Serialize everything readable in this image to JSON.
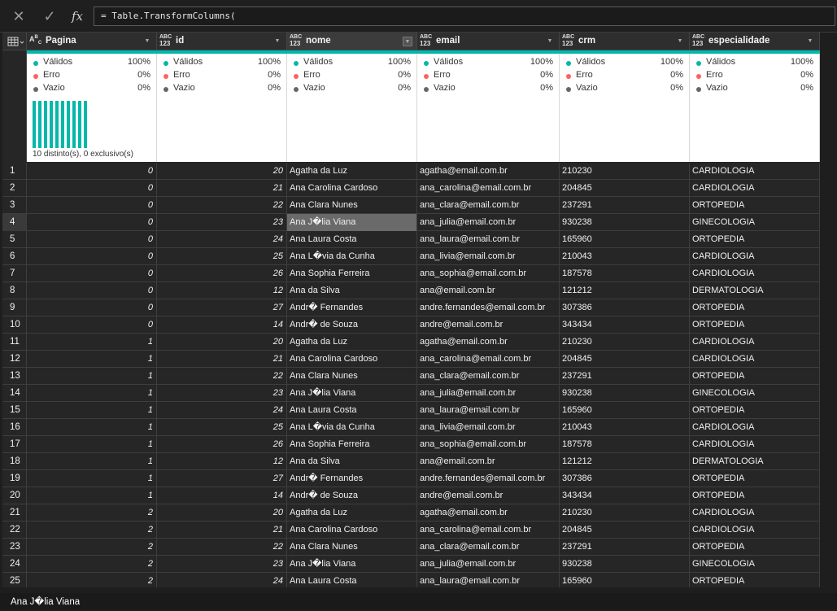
{
  "formula_bar": {
    "cancel_icon": "close-icon",
    "confirm_icon": "check-icon",
    "fx_label": "fx",
    "formula": "= Table.TransformColumns("
  },
  "columns": [
    {
      "name": "Pagina",
      "type": "ABC",
      "valid": "100%",
      "error": "0%",
      "empty": "0%",
      "numeric": true
    },
    {
      "name": "id",
      "type": "ABC123",
      "valid": "100%",
      "error": "0%",
      "empty": "0%",
      "numeric": true
    },
    {
      "name": "nome",
      "type": "ABC123",
      "valid": "100%",
      "error": "0%",
      "empty": "0%",
      "numeric": false
    },
    {
      "name": "email",
      "type": "ABC123",
      "valid": "100%",
      "error": "0%",
      "empty": "0%",
      "numeric": false
    },
    {
      "name": "crm",
      "type": "ABC123",
      "valid": "100%",
      "error": "0%",
      "empty": "0%",
      "numeric": false
    },
    {
      "name": "especialidade",
      "type": "ABC123",
      "valid": "100%",
      "error": "0%",
      "empty": "0%",
      "numeric": false
    }
  ],
  "profile_labels": {
    "valid": "Válidos",
    "error": "Erro",
    "empty": "Vazio"
  },
  "profile_colors": {
    "valid": "#01b8aa",
    "error": "#fd625e",
    "empty": "#666666",
    "accent": "#01b8aa"
  },
  "distinct_text": "10 distinto(s), 0 exclusivo(s)",
  "distinct_bar_count": 10,
  "rows": [
    [
      "1",
      "0",
      "20",
      "Agatha da Luz",
      "agatha@email.com.br",
      "210230",
      "CARDIOLOGIA"
    ],
    [
      "2",
      "0",
      "21",
      "Ana Carolina Cardoso",
      "ana_carolina@email.com.br",
      "204845",
      "CARDIOLOGIA"
    ],
    [
      "3",
      "0",
      "22",
      "Ana Clara Nunes",
      "ana_clara@email.com.br",
      "237291",
      "ORTOPEDIA"
    ],
    [
      "4",
      "0",
      "23",
      "Ana J�lia Viana",
      "ana_julia@email.com.br",
      "930238",
      "GINECOLOGIA"
    ],
    [
      "5",
      "0",
      "24",
      "Ana Laura Costa",
      "ana_laura@email.com.br",
      "165960",
      "ORTOPEDIA"
    ],
    [
      "6",
      "0",
      "25",
      "Ana L�via da Cunha",
      "ana_livia@email.com.br",
      "210043",
      "CARDIOLOGIA"
    ],
    [
      "7",
      "0",
      "26",
      "Ana Sophia Ferreira",
      "ana_sophia@email.com.br",
      "187578",
      "CARDIOLOGIA"
    ],
    [
      "8",
      "0",
      "12",
      "Ana da Silva",
      "ana@email.com.br",
      "121212",
      "DERMATOLOGIA"
    ],
    [
      "9",
      "0",
      "27",
      "Andr� Fernandes",
      "andre.fernandes@email.com.br",
      "307386",
      "ORTOPEDIA"
    ],
    [
      "10",
      "0",
      "14",
      "Andr� de Souza",
      "andre@email.com.br",
      "343434",
      "ORTOPEDIA"
    ],
    [
      "11",
      "1",
      "20",
      "Agatha da Luz",
      "agatha@email.com.br",
      "210230",
      "CARDIOLOGIA"
    ],
    [
      "12",
      "1",
      "21",
      "Ana Carolina Cardoso",
      "ana_carolina@email.com.br",
      "204845",
      "CARDIOLOGIA"
    ],
    [
      "13",
      "1",
      "22",
      "Ana Clara Nunes",
      "ana_clara@email.com.br",
      "237291",
      "ORTOPEDIA"
    ],
    [
      "14",
      "1",
      "23",
      "Ana J�lia Viana",
      "ana_julia@email.com.br",
      "930238",
      "GINECOLOGIA"
    ],
    [
      "15",
      "1",
      "24",
      "Ana Laura Costa",
      "ana_laura@email.com.br",
      "165960",
      "ORTOPEDIA"
    ],
    [
      "16",
      "1",
      "25",
      "Ana L�via da Cunha",
      "ana_livia@email.com.br",
      "210043",
      "CARDIOLOGIA"
    ],
    [
      "17",
      "1",
      "26",
      "Ana Sophia Ferreira",
      "ana_sophia@email.com.br",
      "187578",
      "CARDIOLOGIA"
    ],
    [
      "18",
      "1",
      "12",
      "Ana da Silva",
      "ana@email.com.br",
      "121212",
      "DERMATOLOGIA"
    ],
    [
      "19",
      "1",
      "27",
      "Andr� Fernandes",
      "andre.fernandes@email.com.br",
      "307386",
      "ORTOPEDIA"
    ],
    [
      "20",
      "1",
      "14",
      "Andr� de Souza",
      "andre@email.com.br",
      "343434",
      "ORTOPEDIA"
    ],
    [
      "21",
      "2",
      "20",
      "Agatha da Luz",
      "agatha@email.com.br",
      "210230",
      "CARDIOLOGIA"
    ],
    [
      "22",
      "2",
      "21",
      "Ana Carolina Cardoso",
      "ana_carolina@email.com.br",
      "204845",
      "CARDIOLOGIA"
    ],
    [
      "23",
      "2",
      "22",
      "Ana Clara Nunes",
      "ana_clara@email.com.br",
      "237291",
      "ORTOPEDIA"
    ],
    [
      "24",
      "2",
      "23",
      "Ana J�lia Viana",
      "ana_julia@email.com.br",
      "930238",
      "GINECOLOGIA"
    ],
    [
      "25",
      "2",
      "24",
      "Ana Laura Costa",
      "ana_laura@email.com.br",
      "165960",
      "ORTOPEDIA"
    ]
  ],
  "selected": {
    "row": 4,
    "column": "nome"
  },
  "status_bar": {
    "text": "Ana J�lia Viana"
  }
}
